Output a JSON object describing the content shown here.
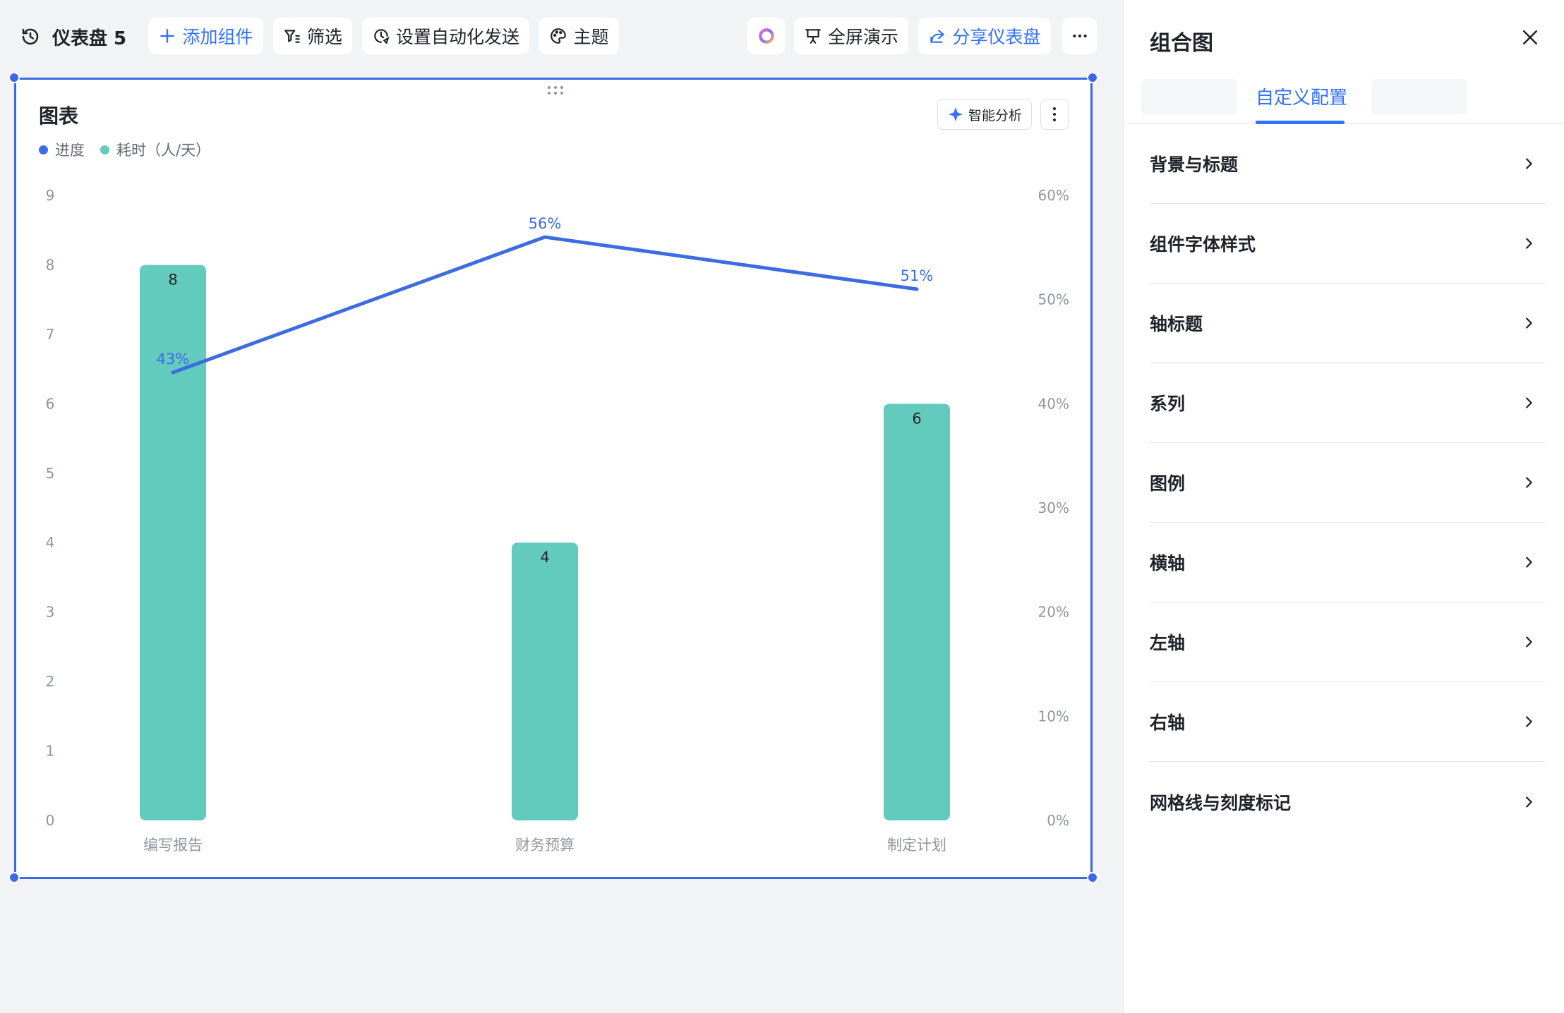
{
  "toolbar": {
    "dashboard_title": "仪表盘 5",
    "add_widget": "添加组件",
    "filter": "筛选",
    "auto_send": "设置自动化发送",
    "theme": "主题",
    "fullscreen": "全屏演示",
    "share": "分享仪表盘"
  },
  "card": {
    "title": "图表",
    "ai_analysis": "智能分析"
  },
  "colors": {
    "accent": "#3370ff",
    "selection": "#3b68e5",
    "line": "#3d6ce0",
    "bar": "#62cbbe"
  },
  "chart_data": {
    "type": "bar+line",
    "categories": [
      "编写报告",
      "财务预算",
      "制定计划"
    ],
    "series": [
      {
        "name": "耗时（人/天）",
        "kind": "bar",
        "axis": "left",
        "values": [
          8,
          4,
          6
        ],
        "labels": [
          "8",
          "4",
          "6"
        ],
        "color": "#62cbbe"
      },
      {
        "name": "进度",
        "kind": "line",
        "axis": "right",
        "values": [
          0.43,
          0.56,
          0.51
        ],
        "labels": [
          "43%",
          "56%",
          "51%"
        ],
        "color": "#3d6ce0"
      }
    ],
    "left_axis": {
      "min": 0,
      "max": 9,
      "ticks": [
        "0",
        "1",
        "2",
        "3",
        "4",
        "5",
        "6",
        "7",
        "8",
        "9"
      ]
    },
    "right_axis": {
      "min": 0,
      "max": 0.6,
      "ticks": [
        "0%",
        "10%",
        "20%",
        "30%",
        "40%",
        "50%",
        "60%"
      ]
    },
    "legend_position": "top-left",
    "grid": false
  },
  "panel": {
    "title": "组合图",
    "active_tab": "自定义配置",
    "items": [
      {
        "label": "背景与标题"
      },
      {
        "label": "组件字体样式"
      },
      {
        "label": "轴标题"
      },
      {
        "label": "系列"
      },
      {
        "label": "图例"
      },
      {
        "label": "横轴"
      },
      {
        "label": "左轴"
      },
      {
        "label": "右轴"
      },
      {
        "label": "网格线与刻度标记"
      }
    ]
  }
}
